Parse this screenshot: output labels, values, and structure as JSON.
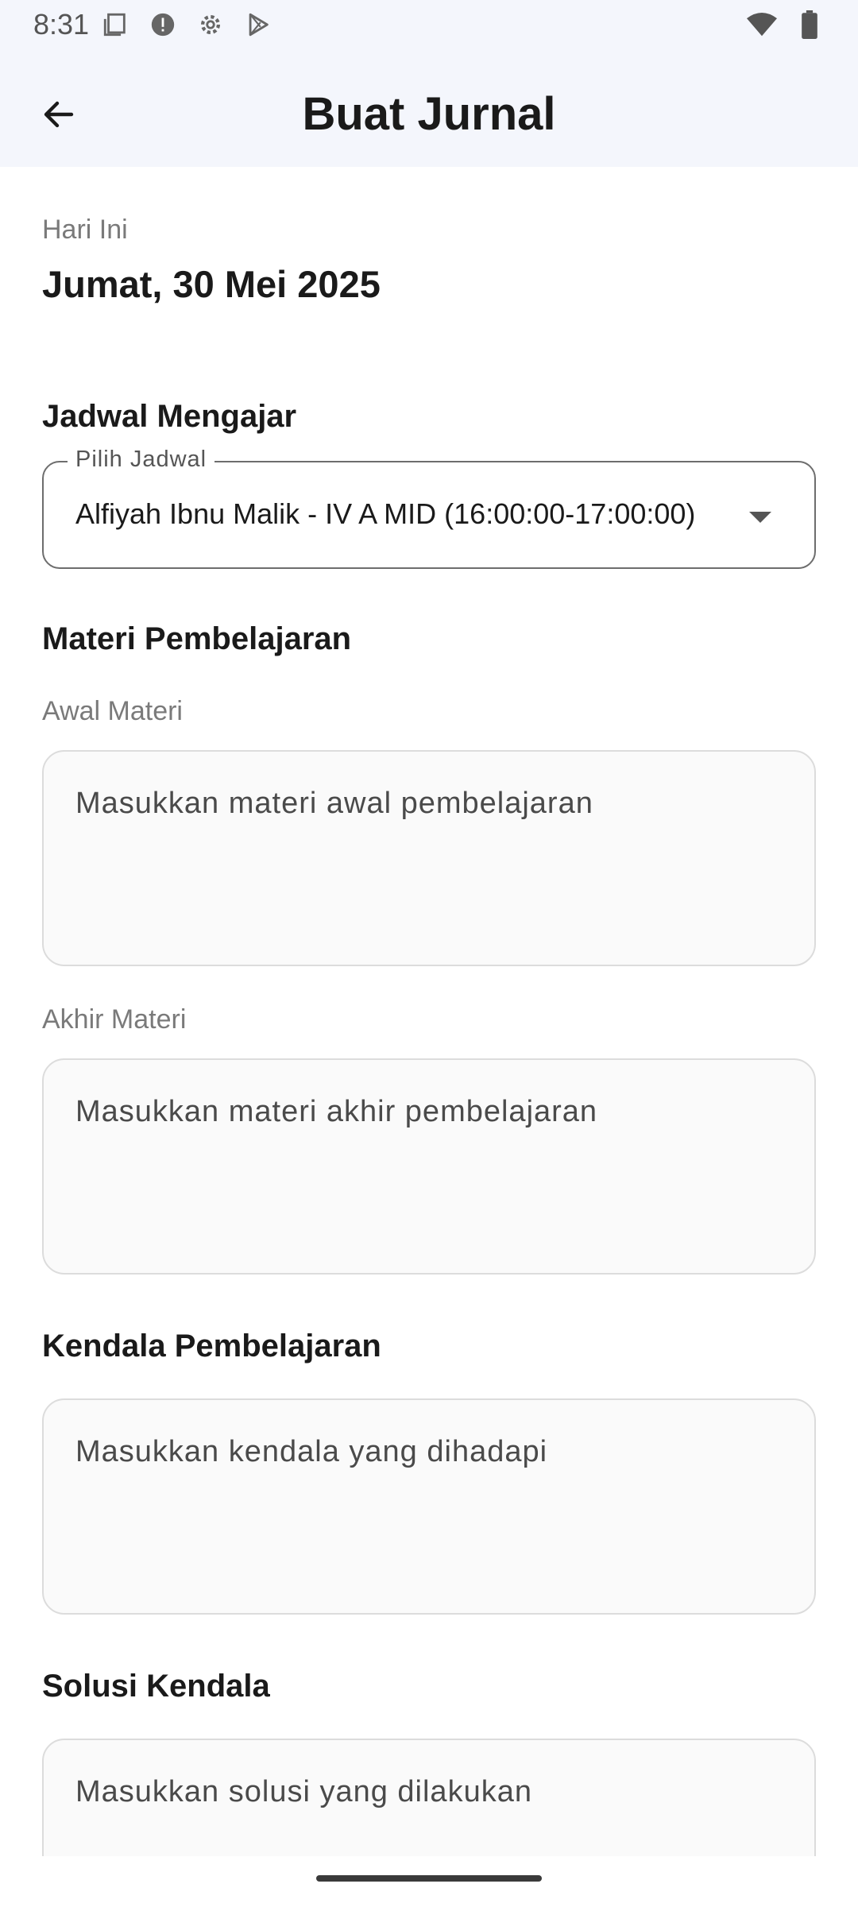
{
  "status_bar": {
    "time": "8:31",
    "left_icons": [
      "screenshot-icon",
      "alert-icon",
      "settings-icon",
      "play-store-icon"
    ],
    "right_icons": [
      "wifi-icon",
      "battery-icon"
    ]
  },
  "app_bar": {
    "title": "Buat Jurnal",
    "back_icon": "arrow-back-icon"
  },
  "today": {
    "label": "Hari Ini",
    "date": "Jumat, 30 Mei 2025"
  },
  "schedule": {
    "section_title": "Jadwal Mengajar",
    "dropdown_label": "Pilih Jadwal",
    "selected": "Alfiyah Ibnu Malik - IV A MID (16:00:00-17:00:00)"
  },
  "materials": {
    "section_title": "Materi Pembelajaran",
    "start_label": "Awal Materi",
    "start_placeholder": "Masukkan materi awal pembelajaran",
    "end_label": "Akhir Materi",
    "end_placeholder": "Masukkan materi akhir pembelajaran"
  },
  "obstacles": {
    "section_title": "Kendala Pembelajaran",
    "placeholder": "Masukkan kendala yang dihadapi"
  },
  "solutions": {
    "section_title": "Solusi Kendala",
    "placeholder": "Masukkan solusi yang dilakukan"
  }
}
